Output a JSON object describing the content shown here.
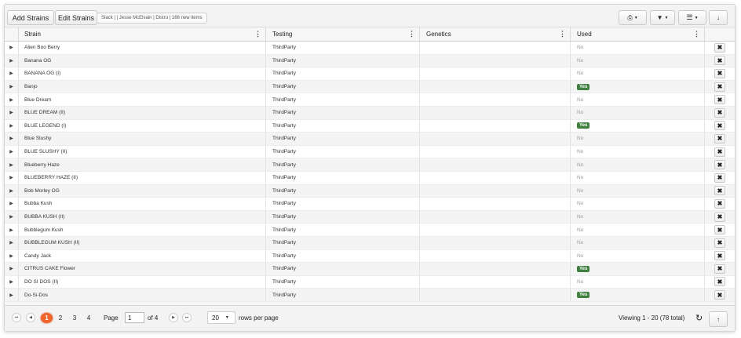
{
  "toolbar": {
    "add_label": "Add Strains",
    "edit_label": "Edit Strains",
    "info": "Slack | | Jesse McElvain | Distru | 166 new items",
    "print_icon": "print-icon",
    "filter_icon": "filter-icon",
    "columns_icon": "columns-icon",
    "download_icon": "download-icon"
  },
  "columns": [
    "Strain",
    "Testing",
    "Genetics",
    "Used"
  ],
  "rows": [
    {
      "strain": "Alien Boo Berry",
      "testing": "ThirdParty",
      "genetics": "",
      "used": "No"
    },
    {
      "strain": "Banana OG",
      "testing": "ThirdParty",
      "genetics": "",
      "used": "No"
    },
    {
      "strain": "BANANA OG (I)",
      "testing": "ThirdParty",
      "genetics": "",
      "used": "No"
    },
    {
      "strain": "Banjo",
      "testing": "ThirdParty",
      "genetics": "",
      "used": "Yes"
    },
    {
      "strain": "Blue Dream",
      "testing": "ThirdParty",
      "genetics": "",
      "used": "No"
    },
    {
      "strain": "BLUE DREAM (II)",
      "testing": "ThirdParty",
      "genetics": "",
      "used": "No"
    },
    {
      "strain": "BLUE LEGEND (I)",
      "testing": "ThirdParty",
      "genetics": "",
      "used": "Yes"
    },
    {
      "strain": "Blue Slushy",
      "testing": "ThirdParty",
      "genetics": "",
      "used": "No"
    },
    {
      "strain": "BLUE SLUSHY (II)",
      "testing": "ThirdParty",
      "genetics": "",
      "used": "No"
    },
    {
      "strain": "Blueberry Haze",
      "testing": "ThirdParty",
      "genetics": "",
      "used": "No"
    },
    {
      "strain": "BLUEBERRY HAZE (II)",
      "testing": "ThirdParty",
      "genetics": "",
      "used": "No"
    },
    {
      "strain": "Bob Morley OG",
      "testing": "ThirdParty",
      "genetics": "",
      "used": "No"
    },
    {
      "strain": "Bubba Kush",
      "testing": "ThirdParty",
      "genetics": "",
      "used": "No"
    },
    {
      "strain": "BUBBA KUSH (II)",
      "testing": "ThirdParty",
      "genetics": "",
      "used": "No"
    },
    {
      "strain": "Bubblegum Kush",
      "testing": "ThirdParty",
      "genetics": "",
      "used": "No"
    },
    {
      "strain": "BUBBLEGUM KUSH (II)",
      "testing": "ThirdParty",
      "genetics": "",
      "used": "No"
    },
    {
      "strain": "Candy Jack",
      "testing": "ThirdParty",
      "genetics": "",
      "used": "No"
    },
    {
      "strain": "CITRUS CAKE Flower",
      "testing": "ThirdParty",
      "genetics": "",
      "used": "Yes"
    },
    {
      "strain": "DO SI DOS (II)",
      "testing": "ThirdParty",
      "genetics": "",
      "used": "No"
    },
    {
      "strain": "Do-Si-Dos",
      "testing": "ThirdParty",
      "genetics": "",
      "used": "Yes"
    }
  ],
  "pagination": {
    "pages": [
      "1",
      "2",
      "3",
      "4"
    ],
    "current": "1",
    "page_label": "Page",
    "page_value": "1",
    "of_label": "of 4",
    "rows_per_page": "20",
    "rows_per_page_label": "rows per page",
    "viewing": "Viewing 1 - 20 (78 total)"
  },
  "colors": {
    "yes_badge": "#3f7f3f",
    "active_page": "#f0642b"
  }
}
